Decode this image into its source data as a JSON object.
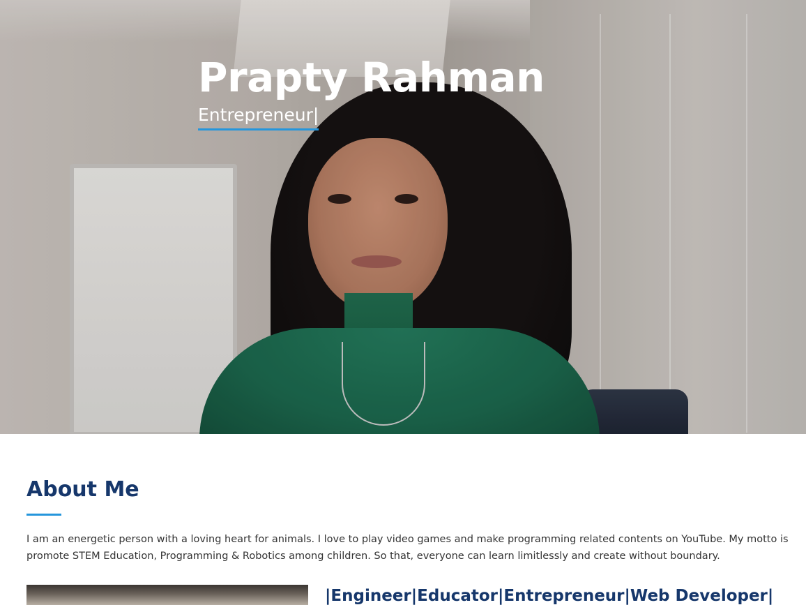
{
  "hero": {
    "name": "Prapty Rahman",
    "role_typed": "Entrepreneur|",
    "accent_color": "#2596dc"
  },
  "about": {
    "title": "About Me",
    "paragraph_lines": [
      "I am an energetic person with a loving heart for animals. I love to play video games and make programming related contents on YouTube. My motto is",
      "promote STEM Education, Programming & Robotics among children. So that, everyone can learn limitlessly and create without boundary."
    ],
    "title_color": "#16376b"
  },
  "roles_line": "|Engineer|Educator|Entrepreneur|Web Developer|"
}
